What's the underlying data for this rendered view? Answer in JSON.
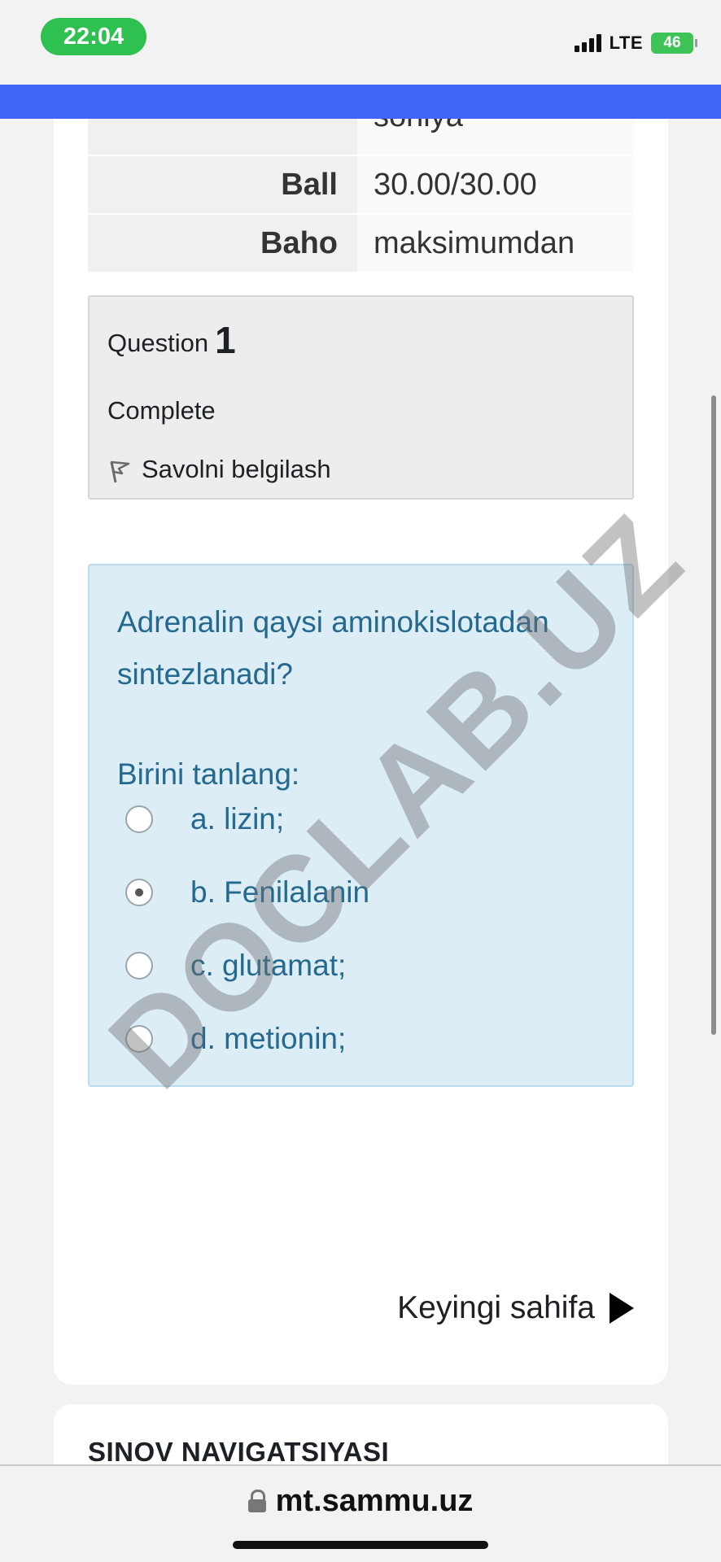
{
  "status_bar": {
    "time": "22:04",
    "network": "LTE",
    "battery": "46",
    "battery_icon": "battery-charging-icon",
    "signal_icon": "signal-bars-icon"
  },
  "summary_table": {
    "rows": [
      {
        "label": "",
        "value": "soniya"
      },
      {
        "label": "Ball",
        "value": "30.00/30.00"
      },
      {
        "label": "Baho",
        "value": "maksimumdan"
      }
    ]
  },
  "question_info": {
    "question_label": "Question",
    "question_number": "1",
    "state": "Complete",
    "flag_label": "Savolni belgilash",
    "flag_icon": "flag-icon"
  },
  "question": {
    "text": "Adrenalin qaysi aminokislotadan sintezlanadi?",
    "prompt": "Birini tanlang:",
    "answers": [
      {
        "label": "a. lizin;",
        "checked": false
      },
      {
        "label": "b. Fenilalanin",
        "checked": true
      },
      {
        "label": "c. glutamat;",
        "checked": false
      },
      {
        "label": "d. metionin;",
        "checked": false
      }
    ]
  },
  "next_page": {
    "label": "Keyingi sahifa",
    "icon": "play-arrow-icon"
  },
  "navigation": {
    "title": "SINOV NAVIGATSIYASI"
  },
  "browser": {
    "url": "mt.sammu.uz",
    "lock_icon": "lock-icon"
  },
  "watermark": "DOCLAB.UZ",
  "colors": {
    "navbar": "#3f66f5",
    "question_bg": "#dcedf6",
    "question_text": "#25698f",
    "time_pill": "#2fc14f"
  }
}
